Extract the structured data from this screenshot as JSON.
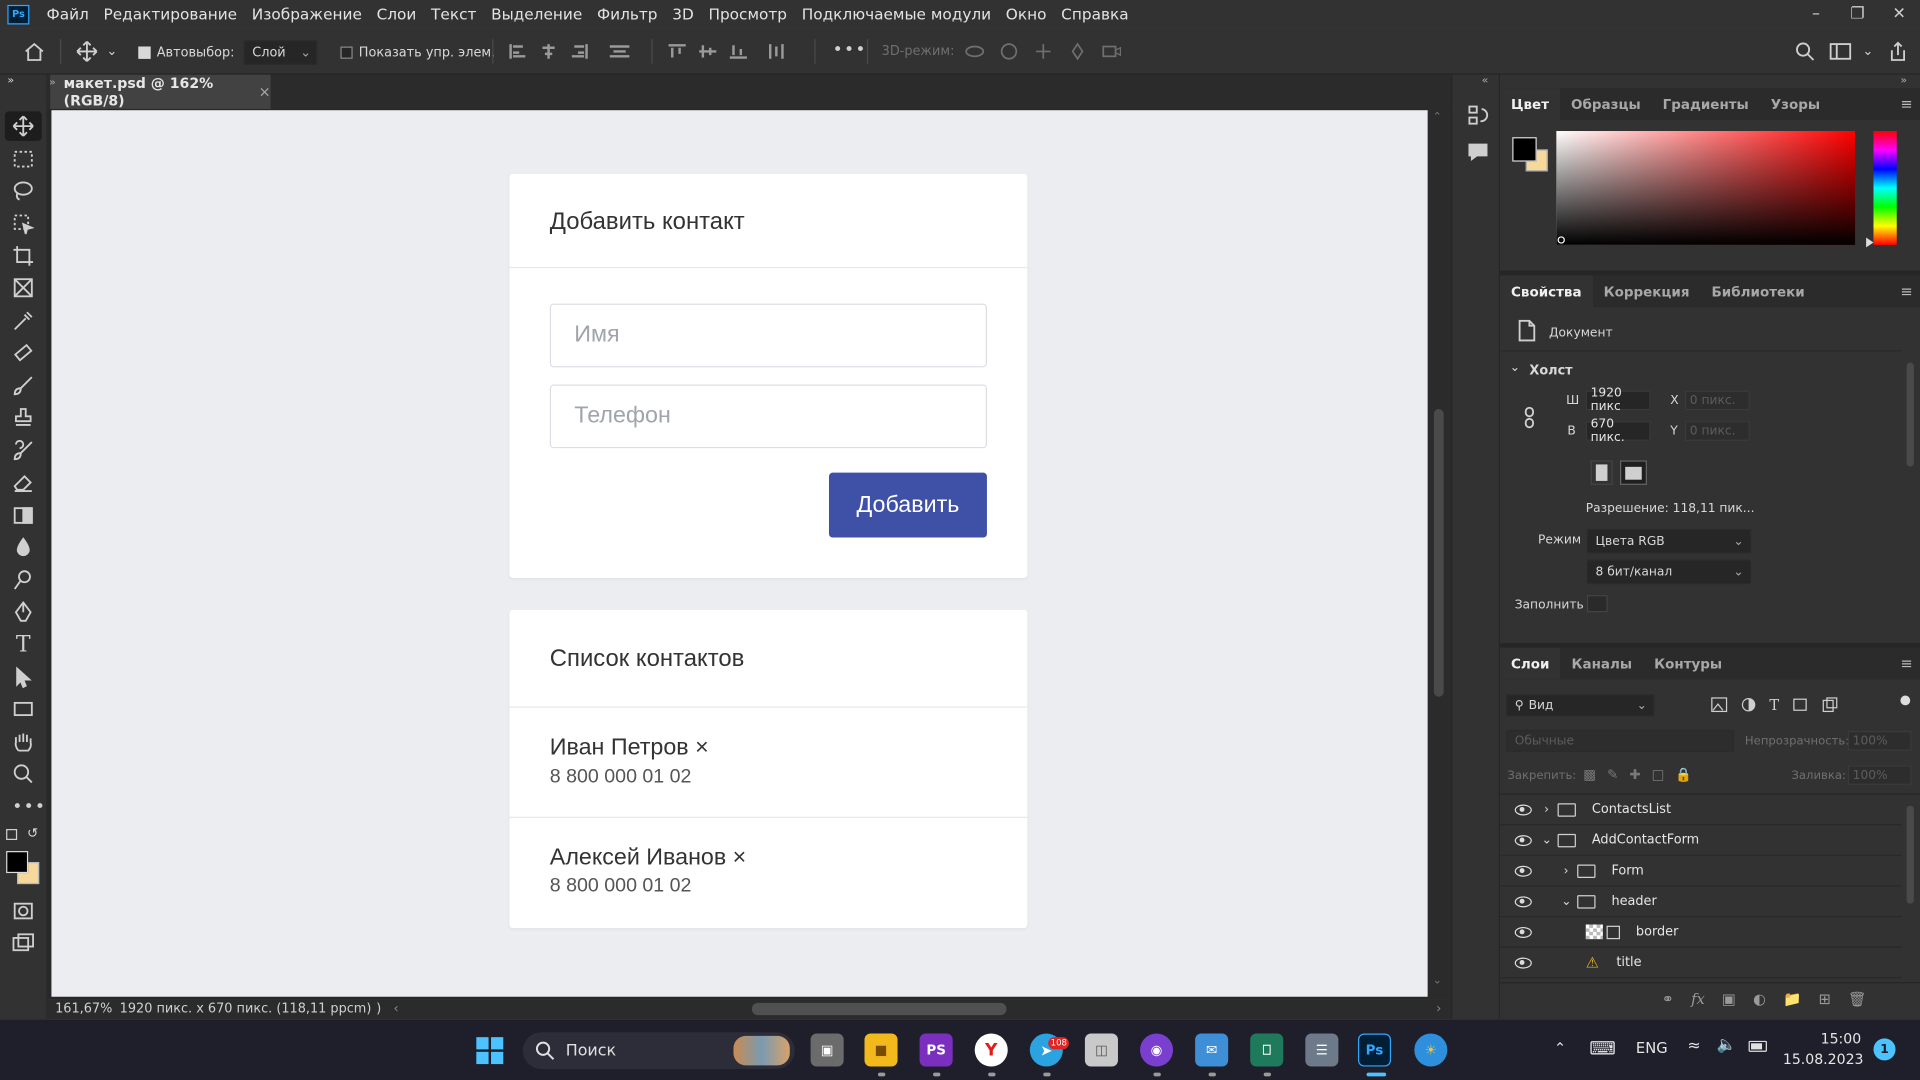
{
  "menu": {
    "app_logo": "Ps",
    "items": [
      "Файл",
      "Редактирование",
      "Изображение",
      "Слои",
      "Текст",
      "Выделение",
      "Фильтр",
      "3D",
      "Просмотр",
      "Подключаемые модули",
      "Окно",
      "Справка"
    ]
  },
  "options": {
    "autoselect_label": "Автовыбор:",
    "autoselect_checked": true,
    "autoselect_target": "Слой",
    "show_transform_label": "Показать упр. элем.",
    "show_transform_checked": false,
    "mode_3d_label": "3D-режим:"
  },
  "document": {
    "tab_title": "макет.psd @ 162% (RGB/8)",
    "close_glyph": "×"
  },
  "canvas": {
    "add_card": {
      "title": "Добавить контакт",
      "name_placeholder": "Имя",
      "phone_placeholder": "Телефон",
      "button_label": "Добавить",
      "button_color": "#3f51a7"
    },
    "list_card": {
      "title": "Список контактов",
      "contacts": [
        {
          "name": "Иван Петров ×",
          "phone": "8 800 000 01 02"
        },
        {
          "name": "Алексей Иванов ×",
          "phone": "8 800 000 01 02"
        }
      ]
    },
    "background_color": "#ebedf1"
  },
  "status": {
    "zoom": "161,67%",
    "info": "1920 пикс. x 670 пикс. (118,11 ppcm)",
    "arrow": ")"
  },
  "color_panel": {
    "tabs": [
      "Цвет",
      "Образцы",
      "Градиенты",
      "Узоры"
    ],
    "active_tab": 0,
    "foreground": "#000000",
    "background": "#f5d89a"
  },
  "properties_panel": {
    "tabs": [
      "Свойства",
      "Коррекция",
      "Библиотеки"
    ],
    "active_tab": 0,
    "doc_label": "Документ",
    "canvas_section": "Холст",
    "width_label": "Ш",
    "width_value": "1920 пикс",
    "height_label": "В",
    "height_value": "670 пикс.",
    "x_label": "X",
    "x_placeholder": "0 пикс.",
    "y_label": "Y",
    "y_placeholder": "0 пикс.",
    "resolution": "Разрешение: 118,11 пик...",
    "mode_label": "Режим",
    "mode_value": "Цвета RGB",
    "depth_value": "8 бит/канал",
    "fill_label": "Заполнить"
  },
  "layers_panel": {
    "tabs": [
      "Слои",
      "Каналы",
      "Контуры"
    ],
    "active_tab": 0,
    "filter_label": "Вид",
    "blend_mode": "Обычные",
    "opacity_label": "Непрозрачность:",
    "opacity_value": "100%",
    "lock_label": "Закрепить:",
    "fill_label": "Заливка:",
    "fill_value": "100%",
    "layers": [
      {
        "name": "ContactsList",
        "kind": "group",
        "expanded": false,
        "indent": 0
      },
      {
        "name": "AddContactForm",
        "kind": "group",
        "expanded": true,
        "indent": 0
      },
      {
        "name": "Form",
        "kind": "group",
        "expanded": false,
        "indent": 1
      },
      {
        "name": "header",
        "kind": "group",
        "expanded": true,
        "indent": 1
      },
      {
        "name": "border",
        "kind": "smart",
        "indent": 2
      },
      {
        "name": "title",
        "kind": "text-warning",
        "indent": 2
      }
    ]
  },
  "taskbar": {
    "search_label": "Поиск",
    "language": "ENG",
    "time": "15:00",
    "date": "15.08.2023",
    "notification_count": "1",
    "telegram_badge": "108"
  }
}
